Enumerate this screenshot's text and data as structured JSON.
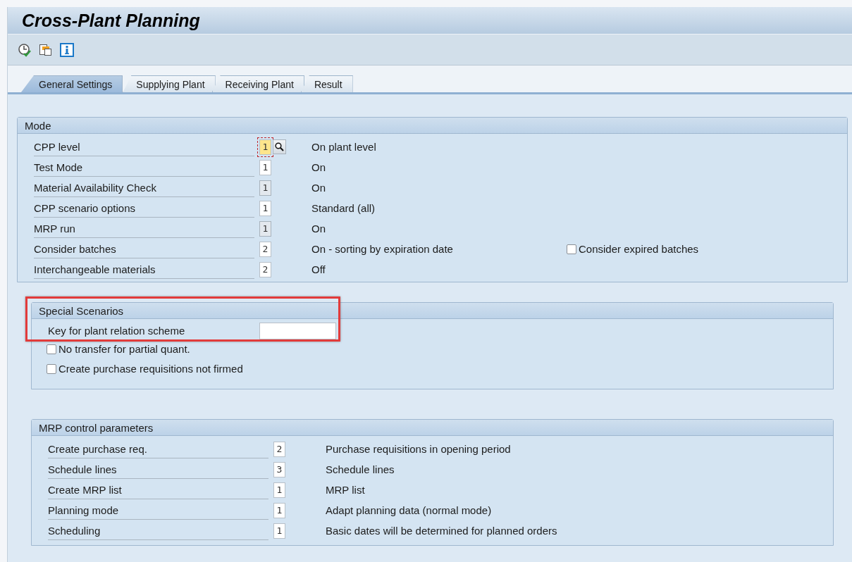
{
  "window": {
    "title": "Cross-Plant Planning"
  },
  "tabs": [
    {
      "label": "General Settings",
      "selected": true
    },
    {
      "label": "Supplying Plant",
      "selected": false
    },
    {
      "label": "Receiving Plant",
      "selected": false
    },
    {
      "label": "Result",
      "selected": false
    }
  ],
  "mode": {
    "title": "Mode",
    "rows": [
      {
        "label": "CPP level",
        "value": "1",
        "description": "On plant level",
        "disabled": false,
        "focused": true
      },
      {
        "label": "Test Mode",
        "value": "1",
        "description": "On",
        "disabled": false,
        "focused": false
      },
      {
        "label": "Material Availability Check",
        "value": "1",
        "description": "On",
        "disabled": true,
        "focused": false
      },
      {
        "label": "CPP scenario options",
        "value": "1",
        "description": "Standard (all)",
        "disabled": false,
        "focused": false
      },
      {
        "label": "MRP run",
        "value": "1",
        "description": "On",
        "disabled": true,
        "focused": false
      },
      {
        "label": "Consider batches",
        "value": "2",
        "description": "On - sorting by expiration date",
        "disabled": false,
        "focused": false,
        "option": {
          "label": "Consider expired batches",
          "checked": false
        }
      },
      {
        "label": "Interchangeable materials",
        "value": "2",
        "description": "Off",
        "disabled": false,
        "focused": false
      }
    ]
  },
  "special_scenarios": {
    "title": "Special Scenarios",
    "highlighted": true,
    "key_field": {
      "label": "Key for plant relation scheme"
    },
    "checkboxes": [
      {
        "label": "No transfer for partial quant.",
        "checked": false
      },
      {
        "label": "Create purchase requisitions not firmed",
        "checked": false
      }
    ]
  },
  "mrp_control": {
    "title": "MRP control parameters",
    "rows": [
      {
        "label": "Create purchase req.",
        "value": "2",
        "description": "Purchase requisitions in opening period",
        "disabled": false,
        "focused": false
      },
      {
        "label": "Schedule lines",
        "value": "3",
        "description": "Schedule lines",
        "disabled": false,
        "focused": false
      },
      {
        "label": "Create MRP list",
        "value": "1",
        "description": "MRP list",
        "disabled": false,
        "focused": false
      },
      {
        "label": "Planning mode",
        "value": "1",
        "description": "Adapt planning data (normal mode)",
        "disabled": false,
        "focused": false
      },
      {
        "label": "Scheduling",
        "value": "1",
        "description": "Basic dates will be determined for planned orders",
        "disabled": false,
        "focused": false
      }
    ]
  }
}
